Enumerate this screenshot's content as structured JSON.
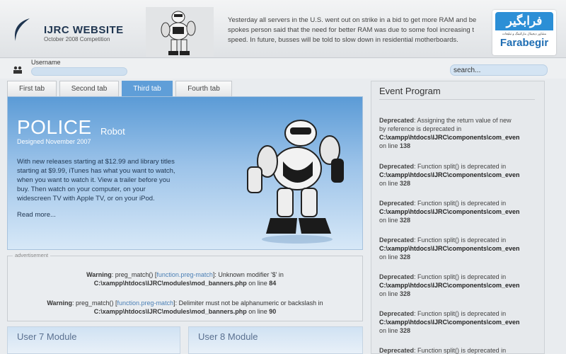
{
  "header": {
    "site_title": "IJRC WEBSITE",
    "site_subtitle": "October 2008 Competition",
    "news_line1": "Yesterday all servers in the U.S. went out on strike in a bid to get more RAM and be",
    "news_line2": "spokes person said that the need for better RAM was due to some fool increasing t",
    "news_line3": "speed. In future, busses will be told to slow down in residential motherboards."
  },
  "brand": {
    "persian": "فرابگیر",
    "sub": "مشاور دیجیتال مارکتینگ و تبلیغات",
    "name": "Farabegir"
  },
  "userbar": {
    "username_label": "Username",
    "username_value": "",
    "search_value": "search..."
  },
  "tabs": [
    {
      "label": "First tab",
      "active": false
    },
    {
      "label": "Second tab",
      "active": false
    },
    {
      "label": "Third tab",
      "active": true
    },
    {
      "label": "Fourth tab",
      "active": false
    }
  ],
  "hero": {
    "title": "POLICE",
    "title_suffix": "Robot",
    "designed": "Designed  November 2007",
    "desc1": "With new releases starting at $12.99 and library titles",
    "desc2": "starting at $9.99, iTunes has what you want to watch,",
    "desc3": "when you want to watch it. View a trailer before you",
    "desc4": "buy. Then watch on your computer, on your",
    "desc5": "widescreen TV with Apple TV, or on your iPod.",
    "read_more": "Read more..."
  },
  "advertisement": {
    "label": "advertisement",
    "warnings": [
      {
        "prefix": "Warning",
        "text1": ": preg_match() [",
        "link": "function.preg-match",
        "text2": "]: Unknown modifier '$' in",
        "path": "C:\\xampp\\htdocs\\IJRC\\modules\\mod_banners.php",
        "line_text": " on line ",
        "line": "84"
      },
      {
        "prefix": "Warning",
        "text1": ": preg_match() [",
        "link": "function.preg-match",
        "text2": "]: Delimiter must not be alphanumeric or backslash in",
        "path": "C:\\xampp\\htdocs\\IJRC\\modules\\mod_banners.php",
        "line_text": " on line ",
        "line": "90"
      }
    ]
  },
  "modules": [
    {
      "title": "User 7 Module"
    },
    {
      "title": "User 8 Module"
    }
  ],
  "sidebar": {
    "title": "Event Program",
    "events": [
      {
        "head": "Deprecated",
        "text": ": Assigning the return value of new",
        "text2": "by reference is deprecated in",
        "path": "C:\\xampp\\htdocs\\IJRC\\components\\com_even",
        "line_text": "on line ",
        "line": "138"
      },
      {
        "head": "Deprecated",
        "text": ": Function split() is deprecated in",
        "text2": "",
        "path": "C:\\xampp\\htdocs\\IJRC\\components\\com_even",
        "line_text": "on line ",
        "line": "328"
      },
      {
        "head": "Deprecated",
        "text": ": Function split() is deprecated in",
        "text2": "",
        "path": "C:\\xampp\\htdocs\\IJRC\\components\\com_even",
        "line_text": "on line ",
        "line": "328"
      },
      {
        "head": "Deprecated",
        "text": ": Function split() is deprecated in",
        "text2": "",
        "path": "C:\\xampp\\htdocs\\IJRC\\components\\com_even",
        "line_text": "on line ",
        "line": "328"
      },
      {
        "head": "Deprecated",
        "text": ": Function split() is deprecated in",
        "text2": "",
        "path": "C:\\xampp\\htdocs\\IJRC\\components\\com_even",
        "line_text": "on line ",
        "line": "328"
      },
      {
        "head": "Deprecated",
        "text": ": Function split() is deprecated in",
        "text2": "",
        "path": "C:\\xampp\\htdocs\\IJRC\\components\\com_even",
        "line_text": "on line ",
        "line": "328"
      },
      {
        "head": "Deprecated",
        "text": ": Function split() is deprecated in",
        "text2": "",
        "path": "",
        "line_text": "",
        "line": ""
      }
    ]
  },
  "colors": {
    "accent": "#5f9ed8",
    "brand_blue": "#2c8fd6",
    "title_dark": "#1f3550"
  }
}
